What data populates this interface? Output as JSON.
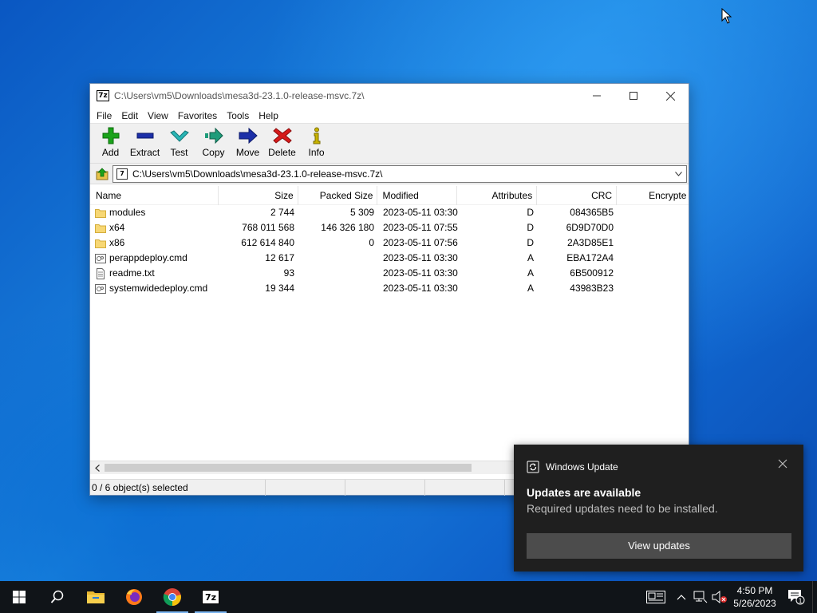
{
  "window": {
    "title": "C:\\Users\\vm5\\Downloads\\mesa3d-23.1.0-release-msvc.7z\\",
    "app_icon_text": "7z"
  },
  "menu": [
    "File",
    "Edit",
    "View",
    "Favorites",
    "Tools",
    "Help"
  ],
  "toolbar": [
    {
      "label": "Add",
      "icon": "plus-icon",
      "color": "#1aa31a"
    },
    {
      "label": "Extract",
      "icon": "minus-icon",
      "color": "#1c2fa8"
    },
    {
      "label": "Test",
      "icon": "check-icon",
      "color": "#29b6b6"
    },
    {
      "label": "Copy",
      "icon": "copy-arrow-icon",
      "color": "#1e9c7a"
    },
    {
      "label": "Move",
      "icon": "move-arrow-icon",
      "color": "#1c2fa8"
    },
    {
      "label": "Delete",
      "icon": "delete-x-icon",
      "color": "#d61a1a"
    },
    {
      "label": "Info",
      "icon": "info-icon",
      "color": "#c9b400"
    }
  ],
  "address": {
    "value": "C:\\Users\\vm5\\Downloads\\mesa3d-23.1.0-release-msvc.7z\\"
  },
  "columns": {
    "name": "Name",
    "size": "Size",
    "packed": "Packed Size",
    "modified": "Modified",
    "attributes": "Attributes",
    "crc": "CRC",
    "encrypted": "Encrypte"
  },
  "files": [
    {
      "name": "modules",
      "type": "folder",
      "size": "2 744",
      "packed": "5 309",
      "modified": "2023-05-11 03:30",
      "attr": "D",
      "crc": "084365B5"
    },
    {
      "name": "x64",
      "type": "folder",
      "size": "768 011 568",
      "packed": "146 326 180",
      "modified": "2023-05-11 07:55",
      "attr": "D",
      "crc": "6D9D70D0"
    },
    {
      "name": "x86",
      "type": "folder",
      "size": "612 614 840",
      "packed": "0",
      "modified": "2023-05-11 07:56",
      "attr": "D",
      "crc": "2A3D85E1"
    },
    {
      "name": "perappdeploy.cmd",
      "type": "cmd",
      "size": "12 617",
      "packed": "",
      "modified": "2023-05-11 03:30",
      "attr": "A",
      "crc": "EBA172A4"
    },
    {
      "name": "readme.txt",
      "type": "txt",
      "size": "93",
      "packed": "",
      "modified": "2023-05-11 03:30",
      "attr": "A",
      "crc": "6B500912"
    },
    {
      "name": "systemwidedeploy.cmd",
      "type": "cmd",
      "size": "19 344",
      "packed": "",
      "modified": "2023-05-11 03:30",
      "attr": "A",
      "crc": "43983B23"
    }
  ],
  "status": {
    "selection": "0 / 6 object(s) selected"
  },
  "toast": {
    "app": "Windows Update",
    "title": "Updates are available",
    "body": "Required updates need to be installed.",
    "button": "View updates"
  },
  "taskbar": {
    "apps": [
      "start-windows-icon",
      "search-icon",
      "file-explorer-icon",
      "firefox-icon",
      "chrome-icon",
      "7zip-icon"
    ],
    "time": "4:50 PM",
    "date": "5/26/2023",
    "notification_count": "1"
  }
}
